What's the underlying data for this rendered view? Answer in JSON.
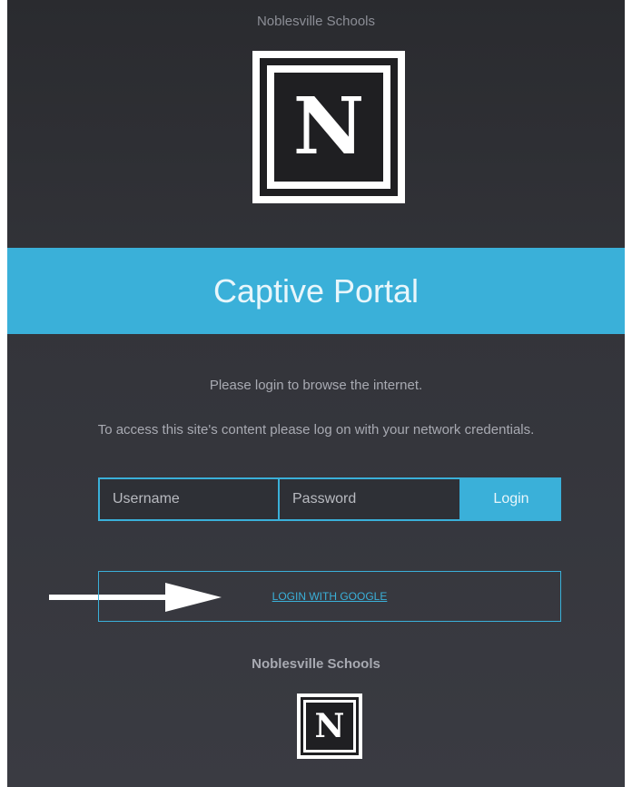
{
  "header": {
    "org_name": "Noblesville Schools",
    "logo_letter": "N"
  },
  "banner": {
    "title": "Captive Portal"
  },
  "messages": {
    "line1": "Please login to browse the internet.",
    "line2": "To access this site's content please log on with your network credentials."
  },
  "login_form": {
    "username_placeholder": "Username",
    "username_value": "",
    "password_placeholder": "Password",
    "password_value": "",
    "submit_label": "Login"
  },
  "google": {
    "link_label": "LOGIN WITH GOOGLE"
  },
  "annotation": {
    "icon": "right-arrow-icon",
    "color": "#ffffff"
  },
  "footer": {
    "org_name": "Noblesville Schools",
    "logo_letter": "N"
  },
  "colors": {
    "accent": "#3ab0d9",
    "background": "#2e3036",
    "muted_text": "#a8aab2"
  }
}
